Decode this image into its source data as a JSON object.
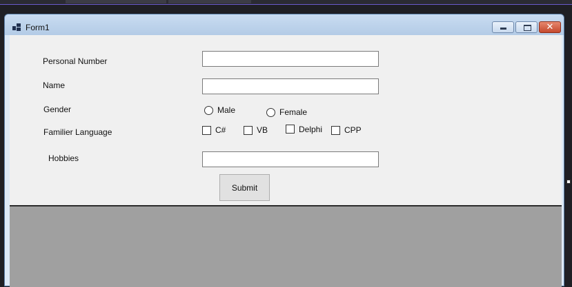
{
  "window": {
    "title": "Form1"
  },
  "form": {
    "personal_number": {
      "label": "Personal Number",
      "value": ""
    },
    "name": {
      "label": "Name",
      "value": ""
    },
    "gender": {
      "label": "Gender",
      "options": [
        "Male",
        "Female"
      ]
    },
    "language": {
      "label": "Familier Language",
      "options": [
        "C#",
        "VB",
        "Delphi",
        "CPP"
      ]
    },
    "hobbies": {
      "label": "Hobbies",
      "value": ""
    },
    "submit_label": "Submit"
  }
}
